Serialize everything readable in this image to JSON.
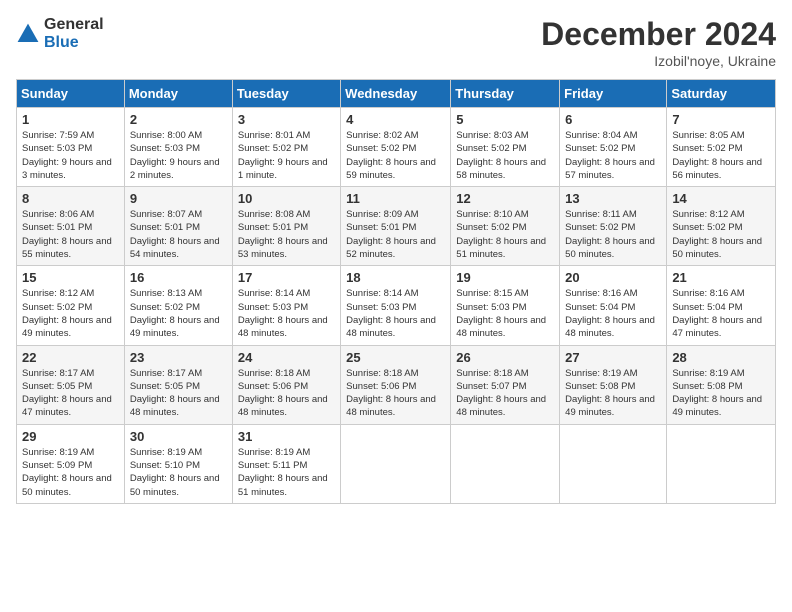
{
  "header": {
    "logo_general": "General",
    "logo_blue": "Blue",
    "month": "December 2024",
    "location": "Izobil'noye, Ukraine"
  },
  "weekdays": [
    "Sunday",
    "Monday",
    "Tuesday",
    "Wednesday",
    "Thursday",
    "Friday",
    "Saturday"
  ],
  "weeks": [
    [
      {
        "day": 1,
        "sunrise": "Sunrise: 7:59 AM",
        "sunset": "Sunset: 5:03 PM",
        "daylight": "Daylight: 9 hours and 3 minutes."
      },
      {
        "day": 2,
        "sunrise": "Sunrise: 8:00 AM",
        "sunset": "Sunset: 5:03 PM",
        "daylight": "Daylight: 9 hours and 2 minutes."
      },
      {
        "day": 3,
        "sunrise": "Sunrise: 8:01 AM",
        "sunset": "Sunset: 5:02 PM",
        "daylight": "Daylight: 9 hours and 1 minute."
      },
      {
        "day": 4,
        "sunrise": "Sunrise: 8:02 AM",
        "sunset": "Sunset: 5:02 PM",
        "daylight": "Daylight: 8 hours and 59 minutes."
      },
      {
        "day": 5,
        "sunrise": "Sunrise: 8:03 AM",
        "sunset": "Sunset: 5:02 PM",
        "daylight": "Daylight: 8 hours and 58 minutes."
      },
      {
        "day": 6,
        "sunrise": "Sunrise: 8:04 AM",
        "sunset": "Sunset: 5:02 PM",
        "daylight": "Daylight: 8 hours and 57 minutes."
      },
      {
        "day": 7,
        "sunrise": "Sunrise: 8:05 AM",
        "sunset": "Sunset: 5:02 PM",
        "daylight": "Daylight: 8 hours and 56 minutes."
      }
    ],
    [
      {
        "day": 8,
        "sunrise": "Sunrise: 8:06 AM",
        "sunset": "Sunset: 5:01 PM",
        "daylight": "Daylight: 8 hours and 55 minutes."
      },
      {
        "day": 9,
        "sunrise": "Sunrise: 8:07 AM",
        "sunset": "Sunset: 5:01 PM",
        "daylight": "Daylight: 8 hours and 54 minutes."
      },
      {
        "day": 10,
        "sunrise": "Sunrise: 8:08 AM",
        "sunset": "Sunset: 5:01 PM",
        "daylight": "Daylight: 8 hours and 53 minutes."
      },
      {
        "day": 11,
        "sunrise": "Sunrise: 8:09 AM",
        "sunset": "Sunset: 5:01 PM",
        "daylight": "Daylight: 8 hours and 52 minutes."
      },
      {
        "day": 12,
        "sunrise": "Sunrise: 8:10 AM",
        "sunset": "Sunset: 5:02 PM",
        "daylight": "Daylight: 8 hours and 51 minutes."
      },
      {
        "day": 13,
        "sunrise": "Sunrise: 8:11 AM",
        "sunset": "Sunset: 5:02 PM",
        "daylight": "Daylight: 8 hours and 50 minutes."
      },
      {
        "day": 14,
        "sunrise": "Sunrise: 8:12 AM",
        "sunset": "Sunset: 5:02 PM",
        "daylight": "Daylight: 8 hours and 50 minutes."
      }
    ],
    [
      {
        "day": 15,
        "sunrise": "Sunrise: 8:12 AM",
        "sunset": "Sunset: 5:02 PM",
        "daylight": "Daylight: 8 hours and 49 minutes."
      },
      {
        "day": 16,
        "sunrise": "Sunrise: 8:13 AM",
        "sunset": "Sunset: 5:02 PM",
        "daylight": "Daylight: 8 hours and 49 minutes."
      },
      {
        "day": 17,
        "sunrise": "Sunrise: 8:14 AM",
        "sunset": "Sunset: 5:03 PM",
        "daylight": "Daylight: 8 hours and 48 minutes."
      },
      {
        "day": 18,
        "sunrise": "Sunrise: 8:14 AM",
        "sunset": "Sunset: 5:03 PM",
        "daylight": "Daylight: 8 hours and 48 minutes."
      },
      {
        "day": 19,
        "sunrise": "Sunrise: 8:15 AM",
        "sunset": "Sunset: 5:03 PM",
        "daylight": "Daylight: 8 hours and 48 minutes."
      },
      {
        "day": 20,
        "sunrise": "Sunrise: 8:16 AM",
        "sunset": "Sunset: 5:04 PM",
        "daylight": "Daylight: 8 hours and 48 minutes."
      },
      {
        "day": 21,
        "sunrise": "Sunrise: 8:16 AM",
        "sunset": "Sunset: 5:04 PM",
        "daylight": "Daylight: 8 hours and 47 minutes."
      }
    ],
    [
      {
        "day": 22,
        "sunrise": "Sunrise: 8:17 AM",
        "sunset": "Sunset: 5:05 PM",
        "daylight": "Daylight: 8 hours and 47 minutes."
      },
      {
        "day": 23,
        "sunrise": "Sunrise: 8:17 AM",
        "sunset": "Sunset: 5:05 PM",
        "daylight": "Daylight: 8 hours and 48 minutes."
      },
      {
        "day": 24,
        "sunrise": "Sunrise: 8:18 AM",
        "sunset": "Sunset: 5:06 PM",
        "daylight": "Daylight: 8 hours and 48 minutes."
      },
      {
        "day": 25,
        "sunrise": "Sunrise: 8:18 AM",
        "sunset": "Sunset: 5:06 PM",
        "daylight": "Daylight: 8 hours and 48 minutes."
      },
      {
        "day": 26,
        "sunrise": "Sunrise: 8:18 AM",
        "sunset": "Sunset: 5:07 PM",
        "daylight": "Daylight: 8 hours and 48 minutes."
      },
      {
        "day": 27,
        "sunrise": "Sunrise: 8:19 AM",
        "sunset": "Sunset: 5:08 PM",
        "daylight": "Daylight: 8 hours and 49 minutes."
      },
      {
        "day": 28,
        "sunrise": "Sunrise: 8:19 AM",
        "sunset": "Sunset: 5:08 PM",
        "daylight": "Daylight: 8 hours and 49 minutes."
      }
    ],
    [
      {
        "day": 29,
        "sunrise": "Sunrise: 8:19 AM",
        "sunset": "Sunset: 5:09 PM",
        "daylight": "Daylight: 8 hours and 50 minutes."
      },
      {
        "day": 30,
        "sunrise": "Sunrise: 8:19 AM",
        "sunset": "Sunset: 5:10 PM",
        "daylight": "Daylight: 8 hours and 50 minutes."
      },
      {
        "day": 31,
        "sunrise": "Sunrise: 8:19 AM",
        "sunset": "Sunset: 5:11 PM",
        "daylight": "Daylight: 8 hours and 51 minutes."
      },
      null,
      null,
      null,
      null
    ]
  ]
}
